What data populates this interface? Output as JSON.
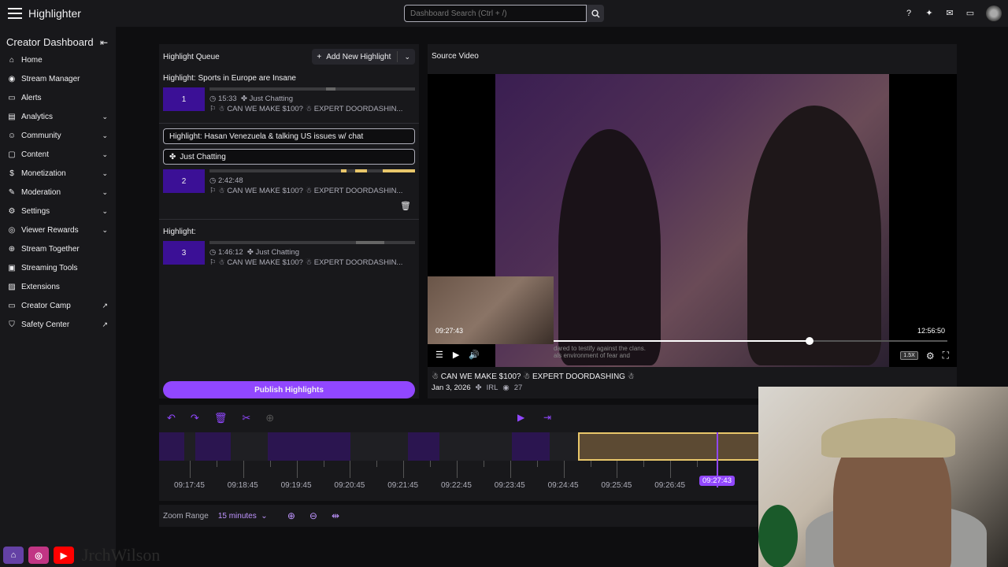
{
  "app": {
    "title": "Highlighter"
  },
  "search": {
    "placeholder": "Dashboard Search (Ctrl + /)"
  },
  "sidebar": {
    "title": "Creator Dashboard",
    "items": [
      {
        "label": "Home",
        "icon": "home-icon",
        "chevron": false,
        "external": false
      },
      {
        "label": "Stream Manager",
        "icon": "stream-manager-icon",
        "chevron": false,
        "external": false
      },
      {
        "label": "Alerts",
        "icon": "alerts-icon",
        "chevron": false,
        "external": false
      },
      {
        "label": "Analytics",
        "icon": "analytics-icon",
        "chevron": true,
        "external": false
      },
      {
        "label": "Community",
        "icon": "community-icon",
        "chevron": true,
        "external": false
      },
      {
        "label": "Content",
        "icon": "content-icon",
        "chevron": true,
        "external": false
      },
      {
        "label": "Monetization",
        "icon": "monetization-icon",
        "chevron": true,
        "external": false
      },
      {
        "label": "Moderation",
        "icon": "moderation-icon",
        "chevron": true,
        "external": false
      },
      {
        "label": "Settings",
        "icon": "settings-icon",
        "chevron": true,
        "external": false
      },
      {
        "label": "Viewer Rewards",
        "icon": "viewer-rewards-icon",
        "chevron": true,
        "external": false
      },
      {
        "label": "Stream Together",
        "icon": "stream-together-icon",
        "chevron": false,
        "external": false
      },
      {
        "label": "Streaming Tools",
        "icon": "streaming-tools-icon",
        "chevron": false,
        "external": false
      },
      {
        "label": "Extensions",
        "icon": "extensions-icon",
        "chevron": false,
        "external": false
      },
      {
        "label": "Creator Camp",
        "icon": "creator-camp-icon",
        "chevron": false,
        "external": true
      },
      {
        "label": "Safety Center",
        "icon": "safety-center-icon",
        "chevron": false,
        "external": true
      }
    ]
  },
  "queue": {
    "title": "Highlight Queue",
    "add_label": "Add New Highlight",
    "publish_label": "Publish Highlights",
    "highlights": [
      {
        "title": "Highlight: Sports in Europe are Insane",
        "number": "1",
        "duration": "15:33",
        "category": "Just Chatting",
        "source": "CAN WE MAKE $100? ☃ EXPERT DOORDASHIN..."
      },
      {
        "title": "Highlight: Hasan Venezuela & talking US issues w/ chat",
        "number": "2",
        "duration": "2:42:48",
        "category": "Just Chatting",
        "source": "CAN WE MAKE $100? ☃ EXPERT DOORDASHIN..."
      },
      {
        "title": "Highlight:",
        "number": "3",
        "duration": "1:46:12",
        "category": "Just Chatting",
        "source": "CAN WE MAKE $100? ☃ EXPERT DOORDASHIN..."
      }
    ]
  },
  "video": {
    "panel_title": "Source Video",
    "current_time": "09:27:43",
    "total_time": "12:56:50",
    "speed": "1.5X",
    "caption": "dared to testify against the clans.",
    "caption2": "als environment of fear and",
    "title": "CAN WE MAKE $100? ☃ EXPERT DOORDASHING ☃",
    "date": "Jan 3, 2026",
    "category": "IRL",
    "views": "27",
    "progress": 0.65
  },
  "timeline": {
    "ticks": [
      "09:17:45",
      "09:18:45",
      "09:19:45",
      "09:20:45",
      "09:21:45",
      "09:22:45",
      "09:23:45",
      "09:24:45",
      "09:25:45",
      "09:26:45"
    ],
    "cursor_label": "09:27:43"
  },
  "zoom": {
    "label": "Zoom Range",
    "value": "15 minutes"
  },
  "social": {
    "handle": "JrchWilson"
  },
  "colors": {
    "accent": "#9147ff",
    "highlight_bar": "#e8c66a",
    "number_box": "#3b1096"
  }
}
